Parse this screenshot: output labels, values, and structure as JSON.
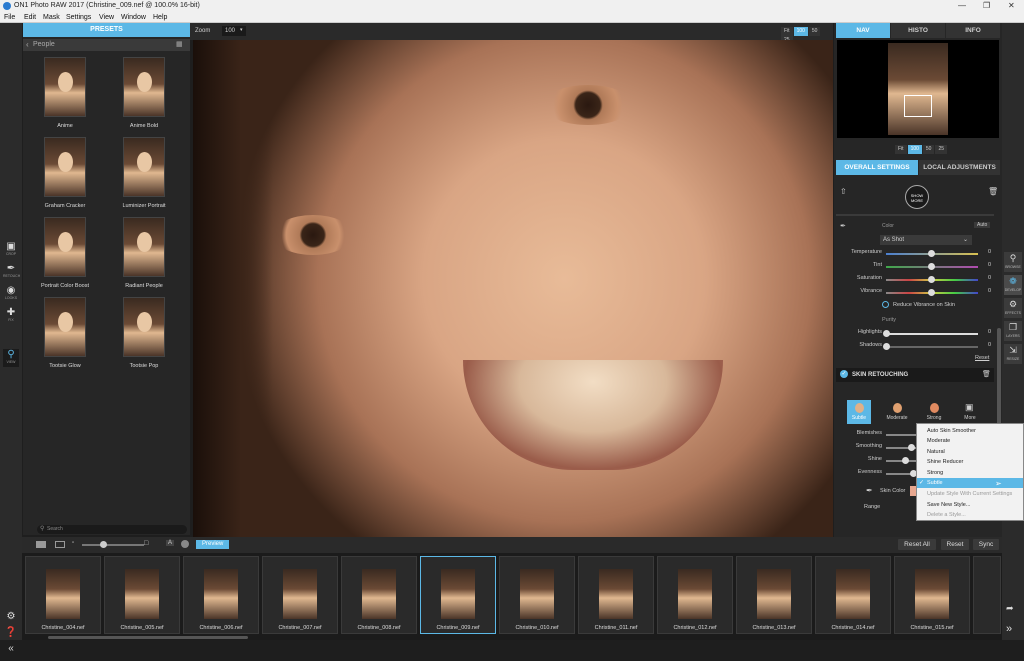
{
  "app": {
    "title": "ON1 Photo RAW 2017 (Christine_009.nef @ 100.0% 16-bit)"
  },
  "menu": [
    "File",
    "Edit",
    "Mask",
    "Settings",
    "View",
    "Window",
    "Help"
  ],
  "left_tools": [
    {
      "label": "CROP",
      "icon": "crop-icon"
    },
    {
      "label": "RETOUCH",
      "icon": "brush-icon"
    },
    {
      "label": "LOOKS",
      "icon": "eye-icon"
    },
    {
      "label": "FIX",
      "icon": "bandage-icon"
    },
    {
      "label": "VIEW",
      "icon": "magnifier-icon"
    }
  ],
  "presets": {
    "header": "PRESETS",
    "category": "People",
    "items": [
      "Anime",
      "Anime Bold",
      "Graham Cracker",
      "Luminizer Portrait",
      "Portrait Color Boost",
      "Radiant People",
      "Tootsie Glow",
      "Tootsie Pop"
    ],
    "search_placeholder": "Search"
  },
  "canvas": {
    "zoom_label": "Zoom",
    "zoom_value": "100",
    "zoom_buttons": [
      "Fit",
      "100",
      "50",
      "25"
    ],
    "active_zoom": "100"
  },
  "right_panel": {
    "tabs": [
      "NAV",
      "HISTO",
      "INFO"
    ],
    "nav_zoom": [
      "Fit",
      "100",
      "50",
      "25"
    ],
    "settings_tabs": [
      "OVERALL SETTINGS",
      "LOCAL ADJUSTMENTS"
    ],
    "show_more": "SHOW MORE",
    "color_label": "Color",
    "color_auto": "Auto",
    "white_balance": "As Shot",
    "color_sliders": [
      {
        "name": "Temperature",
        "value": "0",
        "pos": 0.5
      },
      {
        "name": "Tint",
        "value": "0",
        "pos": 0.5
      },
      {
        "name": "Saturation",
        "value": "0",
        "pos": 0.5
      },
      {
        "name": "Vibrance",
        "value": "0",
        "pos": 0.5
      }
    ],
    "reduce_vibrance": "Reduce Vibrance on Skin",
    "purity": "Purity",
    "purity_sliders": [
      {
        "name": "Highlights",
        "value": "0",
        "pos": 0.0
      },
      {
        "name": "Shadows",
        "value": "0",
        "pos": 0.0
      }
    ],
    "reset": "Reset",
    "skin_title": "SKIN RETOUCHING",
    "skin_styles": [
      "Subtle",
      "Moderate",
      "Strong",
      "More"
    ],
    "skin_sliders": [
      {
        "name": "Blemishes",
        "pos": 0.6
      },
      {
        "name": "Smoothing",
        "pos": 0.55
      },
      {
        "name": "Shine",
        "pos": 0.4
      },
      {
        "name": "Evenness",
        "pos": 0.5
      }
    ],
    "skin_color": "Skin Color",
    "range": "Range"
  },
  "dropdown": {
    "options": [
      "Auto Skin Smoother",
      "Moderate",
      "Natural",
      "Shine Reducer",
      "Strong",
      "Subtle",
      "Update Style With Current Settings",
      "Save New Style...",
      "Delete a Style..."
    ],
    "selected": "Subtle"
  },
  "right_tools": [
    {
      "label": "BROWSE",
      "icon": "browse-icon"
    },
    {
      "label": "DEVELOP",
      "icon": "aperture-icon"
    },
    {
      "label": "EFFECTS",
      "icon": "gear-icon"
    },
    {
      "label": "LAYERS",
      "icon": "layers-icon"
    },
    {
      "label": "RESIZE",
      "icon": "resize-icon"
    }
  ],
  "bottom": {
    "preview": "Preview",
    "reset_all": "Reset All",
    "reset": "Reset",
    "sync": "Sync"
  },
  "filmstrip": [
    "Christine_004.nef",
    "Christine_005.nef",
    "Christine_006.nef",
    "Christine_007.nef",
    "Christine_008.nef",
    "Christine_009.nef",
    "Christine_010.nef",
    "Christine_011.nef",
    "Christine_012.nef",
    "Christine_013.nef",
    "Christine_014.nef",
    "Christine_015.nef"
  ],
  "filmstrip_selected": "Christine_009.nef",
  "colors": {
    "accent": "#5cb8e6",
    "panel": "#262626",
    "dark": "#1e1e1e"
  }
}
